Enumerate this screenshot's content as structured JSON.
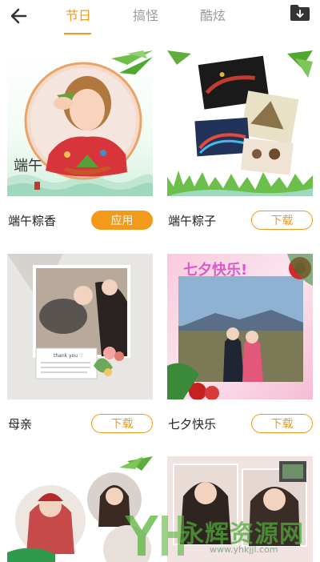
{
  "tabs": [
    {
      "label": "节日",
      "active": true
    },
    {
      "label": "搞怪",
      "active": false
    },
    {
      "label": "酷炫",
      "active": false
    }
  ],
  "cards": [
    {
      "title": "端午粽香",
      "button": "应用",
      "thumb_text": "端午"
    },
    {
      "title": "端午粽子",
      "button": "下载"
    },
    {
      "title": "母亲",
      "button": "下载",
      "thumb_text": "thank you ♡"
    },
    {
      "title": "七夕快乐",
      "button": "下载",
      "thumb_text": "七夕快乐!"
    }
  ],
  "watermark": {
    "text": "永辉资源网",
    "url": "www.yhkjjl.com"
  },
  "colors": {
    "accent": "#f39a1b"
  }
}
